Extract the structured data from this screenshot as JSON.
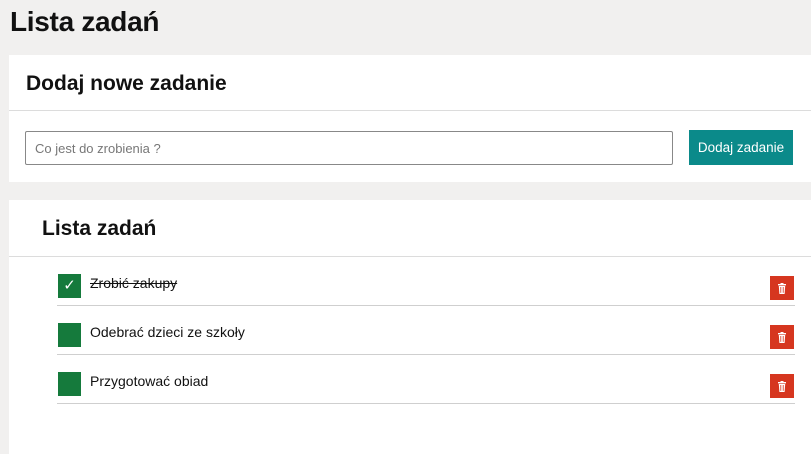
{
  "page": {
    "title": "Lista zadań"
  },
  "add_panel": {
    "title": "Dodaj nowe zadanie",
    "input_placeholder": "Co jest do zrobienia ?",
    "input_value": "",
    "button_label": "Dodaj zadanie",
    "button_color": "#0b8a8a"
  },
  "list_panel": {
    "title": "Lista zadań",
    "tasks": [
      {
        "label": "Zrobić zakupy",
        "done": true,
        "check_glyph": "✓"
      },
      {
        "label": "Odebrać dzieci ze szkoły",
        "done": false,
        "check_glyph": ""
      },
      {
        "label": "Przygotować obiad",
        "done": false,
        "check_glyph": ""
      }
    ],
    "check_color": "#157a3c",
    "delete_icon": "trash-icon",
    "delete_color": "#d6361f"
  }
}
